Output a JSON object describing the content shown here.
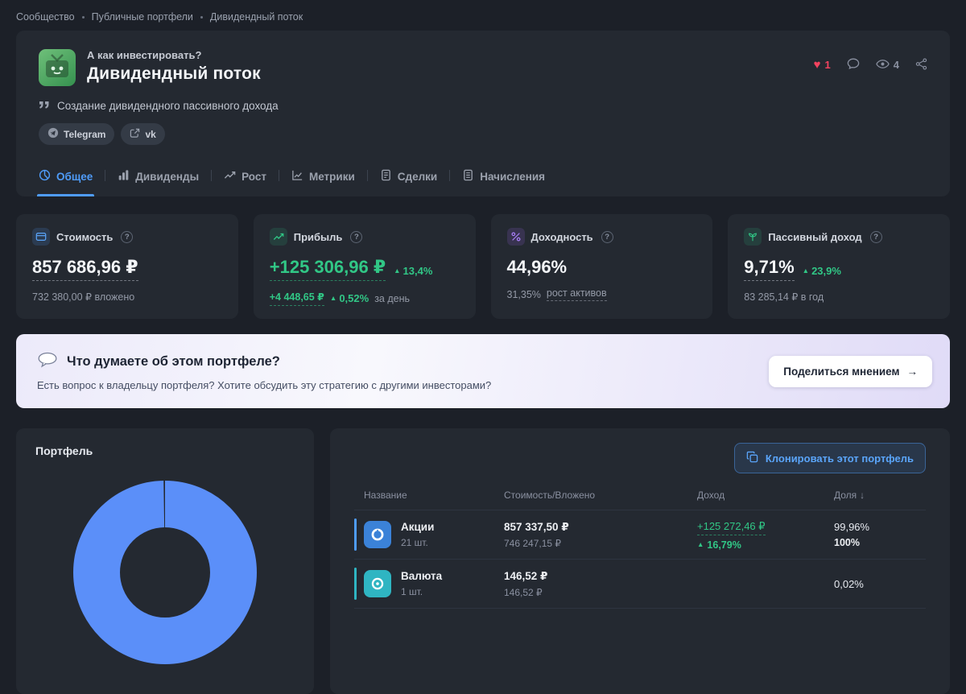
{
  "breadcrumb": {
    "items": [
      "Сообщество",
      "Публичные портфели",
      "Дивидендный поток"
    ]
  },
  "header": {
    "pretitle": "А как инвестировать?",
    "title": "Дивидендный поток",
    "likes": "1",
    "views": "4",
    "quote": "Создание дивидендного пассивного дохода",
    "tags": [
      "Telegram",
      "vk"
    ]
  },
  "tabs": [
    {
      "label": "Общее",
      "active": true
    },
    {
      "label": "Дивиденды",
      "active": false
    },
    {
      "label": "Рост",
      "active": false
    },
    {
      "label": "Метрики",
      "active": false
    },
    {
      "label": "Сделки",
      "active": false
    },
    {
      "label": "Начисления",
      "active": false
    }
  ],
  "stats": [
    {
      "label": "Стоимость",
      "value": "857 686,96 ₽",
      "sub": "732 380,00 ₽ вложено"
    },
    {
      "label": "Прибыль",
      "value": "+125 306,96 ₽",
      "delta": "13,4%",
      "sub_amount": "+4 448,65 ₽",
      "sub_delta": "0,52%",
      "sub_text": "за день"
    },
    {
      "label": "Доходность",
      "value": "44,96%",
      "sub_amount": "31,35%",
      "sub_text": "рост активов"
    },
    {
      "label": "Пассивный доход",
      "value": "9,71%",
      "delta": "23,9%",
      "sub": "83 285,14 ₽ в год"
    }
  ],
  "banner": {
    "title": "Что думаете об этом портфеле?",
    "text": "Есть вопрос к владельцу портфеля? Хотите обсудить эту стратегию с другими инвесторами?",
    "button": "Поделиться мнением"
  },
  "portfolio": {
    "title": "Портфель"
  },
  "holdings": {
    "clone_label": "Клонировать этот портфель",
    "headers": {
      "name": "Название",
      "value": "Стоимость/Вложено",
      "income": "Доход",
      "share": "Доля"
    },
    "rows": [
      {
        "name": "Акции",
        "qty": "21 шт.",
        "value": "857 337,50 ₽",
        "invested": "746 247,15 ₽",
        "income": "+125 272,46 ₽",
        "income_delta": "16,79%",
        "share": "99,96%",
        "share_total": "100%"
      },
      {
        "name": "Валюта",
        "qty": "1 шт.",
        "value": "146,52 ₽",
        "invested": "146,52 ₽",
        "share": "0,02%"
      }
    ]
  },
  "chart_data": {
    "type": "pie",
    "title": "Портфель",
    "labels": [
      "Акции",
      "Валюта"
    ],
    "values": [
      99.96,
      0.02
    ],
    "colors": [
      "#5b8ff9",
      "#2fb5c2"
    ],
    "legend_position": "none"
  },
  "icons": {
    "heart": "♥",
    "triangle_up": "▲",
    "question": "?",
    "arrow_right": "→",
    "arrow_down": "↓"
  },
  "colors": {
    "accent_blue": "#4f9cf9",
    "green": "#31c786",
    "red": "#f4435f",
    "purple": "#a97ef7",
    "teal": "#2fb5c2",
    "donut_blue": "#5b8ff9"
  }
}
